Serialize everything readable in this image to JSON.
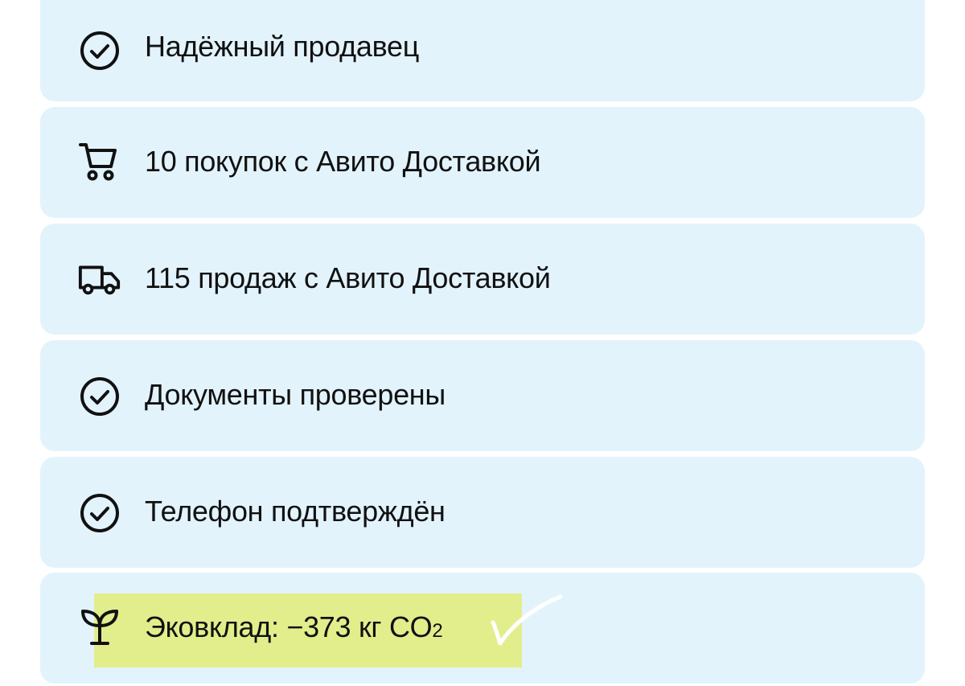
{
  "items": [
    {
      "icon": "check-circle-icon",
      "label": "Надёжный продавец"
    },
    {
      "icon": "cart-icon",
      "label": "10 покупок с Авито Доставкой"
    },
    {
      "icon": "truck-icon",
      "label": "115 продаж с Авито Доставкой"
    },
    {
      "icon": "check-circle-icon",
      "label": "Документы проверены"
    },
    {
      "icon": "check-circle-icon",
      "label": "Телефон подтверждён"
    },
    {
      "icon": "sprout-icon",
      "label_main": "Эковклад: −373 кг CO",
      "label_sub": "2"
    }
  ],
  "colors": {
    "card_background": "#e2f3fc",
    "text": "#111111",
    "highlight": "#e2ee8c"
  }
}
